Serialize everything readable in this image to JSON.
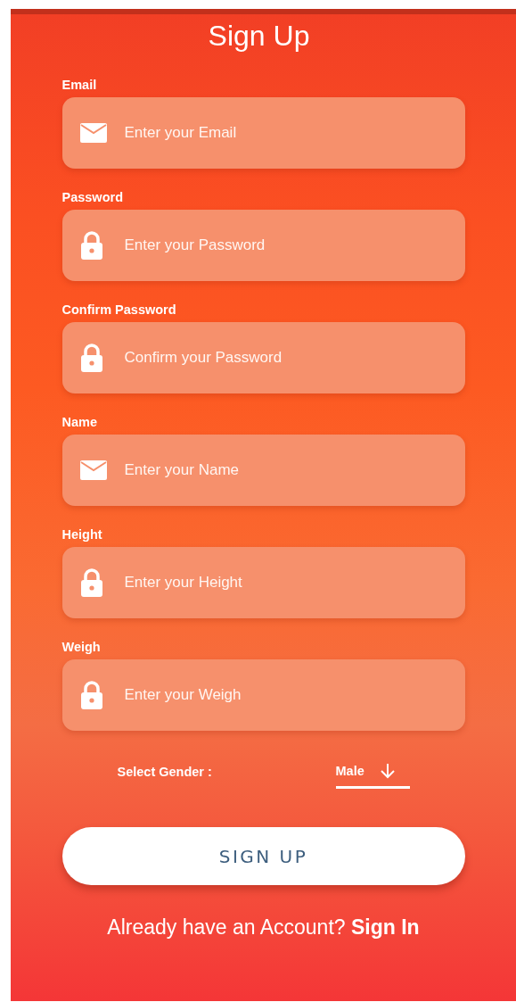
{
  "title": "Sign Up",
  "fields": [
    {
      "label": "Email",
      "placeholder": "Enter your Email",
      "kind": "mail"
    },
    {
      "label": "Password",
      "placeholder": "Enter your Password",
      "kind": "lock"
    },
    {
      "label": "Confirm Password",
      "placeholder": "Confirm your Password",
      "kind": "lock"
    },
    {
      "label": "Name",
      "placeholder": "Enter your Name",
      "kind": "mail"
    },
    {
      "label": "Height",
      "placeholder": "Enter your Height",
      "kind": "lock"
    },
    {
      "label": "Weigh",
      "placeholder": "Enter your Weigh",
      "kind": "lock"
    }
  ],
  "gender": {
    "label": "Select Gender :",
    "value": "Male"
  },
  "submit": "SIGN UP",
  "footer": {
    "prompt": "Already have an Account?",
    "link": "Sign In"
  }
}
